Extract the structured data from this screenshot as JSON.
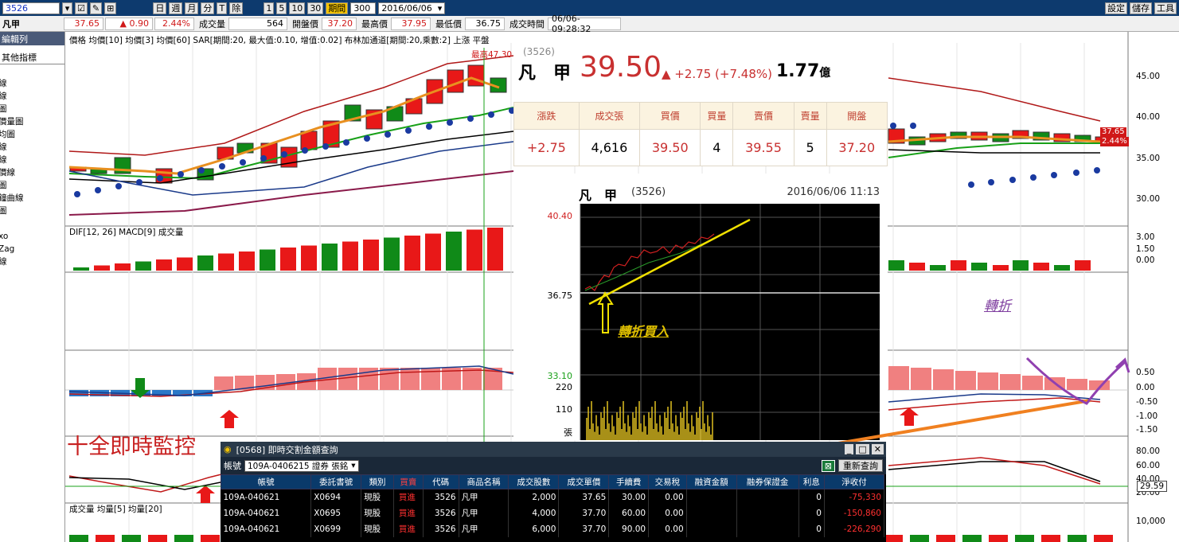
{
  "toolbar": {
    "symbol": "3526",
    "buttons": [
      "日",
      "週",
      "月",
      "分",
      "T",
      "除"
    ],
    "intervals": [
      "1",
      "5",
      "10",
      "30"
    ],
    "period_label": "期間",
    "period_value": "300",
    "date": "2016/06/06",
    "right_buttons": [
      "設定",
      "儲存",
      "工具"
    ]
  },
  "quote": {
    "name": "凡甲",
    "price": "37.65",
    "change": "▲ 0.90",
    "change_pct": "2.44%",
    "volume_label": "成交量",
    "volume": "564",
    "open_label": "開盤價",
    "open": "37.20",
    "high_label": "最高價",
    "high": "37.95",
    "low_label": "最低價",
    "low": "36.75",
    "time_label": "成交時間",
    "time": "06/06-09:28:32"
  },
  "left_panel": {
    "header": "編輯列",
    "tab": "其他指標",
    "items": [
      "線",
      "線",
      "圖",
      "價量圖",
      "均圖",
      "線",
      "線",
      "價線",
      "圖",
      "鐘曲線",
      "圖",
      "i",
      "xo",
      "Zag",
      "線"
    ]
  },
  "main_chart": {
    "legend_price": "價格 均價[10] 均價[3] 均價[60] SAR[期間:20, 最大值:0.10, 增值:0.02] 布林加通道[期間:20,乘數:2] 上漲 平盤",
    "high_marker": "最高47.30",
    "legend_macd": "DIF[12, 26] MACD[9] 成交量",
    "legend_vol": "成交量 均量[5] 均量[20]",
    "right_axis_price": [
      "45.00",
      "40.00",
      "35.00",
      "30.00"
    ],
    "right_axis_macd": [
      "3.00",
      "1.50",
      "0.00"
    ],
    "right_axis_osc": [
      "0.50",
      "0.00",
      "-0.50",
      "-1.00",
      "-1.50"
    ],
    "right_axis_kd": [
      "80.00",
      "60.00",
      "40.00",
      "20.00"
    ],
    "right_axis_vol": [
      "10,000"
    ],
    "price_tag_1": "37.65",
    "price_tag_2": "2.44%",
    "kd_tag": "29.59"
  },
  "overlay": {
    "code": "(3526)",
    "name": "凡　甲",
    "price": "39.50",
    "change": "▲ +2.75 (+7.48%)",
    "amount_value": "1.77",
    "amount_unit": "億",
    "table_headers": [
      "漲跌",
      "成交張",
      "買價",
      "買量",
      "賣價",
      "賣量",
      "開盤"
    ],
    "table_values": [
      "+2.75",
      "4,616",
      "39.50",
      "4",
      "39.55",
      "5",
      "37.20"
    ]
  },
  "mini_chart": {
    "name": "凡　甲",
    "code": "(3526)",
    "datetime": "2016/06/06 11:13",
    "y_labels": [
      "40.40",
      "36.75",
      "33.10"
    ],
    "vol_labels": [
      "220",
      "110"
    ],
    "vol_axis_label": "張"
  },
  "annotations": {
    "buy_note": "轉折買入",
    "turn_note": "轉折",
    "banner": "十全即時監控"
  },
  "popup": {
    "title": "[0568] 即時交割金額查詢",
    "account_label": "帳號",
    "account_value": "109A-0406215 證券 張銘",
    "refresh_button": "重新查詢",
    "columns": [
      "帳號",
      "委託書號",
      "類別",
      "買賣",
      "代碼",
      "商品名稱",
      "成交股數",
      "成交單價",
      "手續費",
      "交易稅",
      "融資金額",
      "融券保證金",
      "利息",
      "淨收付"
    ],
    "rows": [
      [
        "109A-040621",
        "X0694",
        "現股",
        "買進",
        "3526",
        "凡甲",
        "2,000",
        "37.65",
        "30.00",
        "0.00",
        "",
        "",
        "0",
        "-75,330"
      ],
      [
        "109A-040621",
        "X0695",
        "現股",
        "買進",
        "3526",
        "凡甲",
        "4,000",
        "37.70",
        "60.00",
        "0.00",
        "",
        "",
        "0",
        "-150,860"
      ],
      [
        "109A-040621",
        "X0699",
        "現股",
        "買進",
        "3526",
        "凡甲",
        "6,000",
        "37.70",
        "90.00",
        "0.00",
        "",
        "",
        "0",
        "-226,290"
      ]
    ]
  },
  "colors": {
    "up": "#e81818",
    "down": "#108a18",
    "toolbar_bg": "#0d3a6e",
    "annotation_yellow": "#f0e000",
    "annotation_orange": "#f08020",
    "annotation_purple": "#9040b0"
  }
}
